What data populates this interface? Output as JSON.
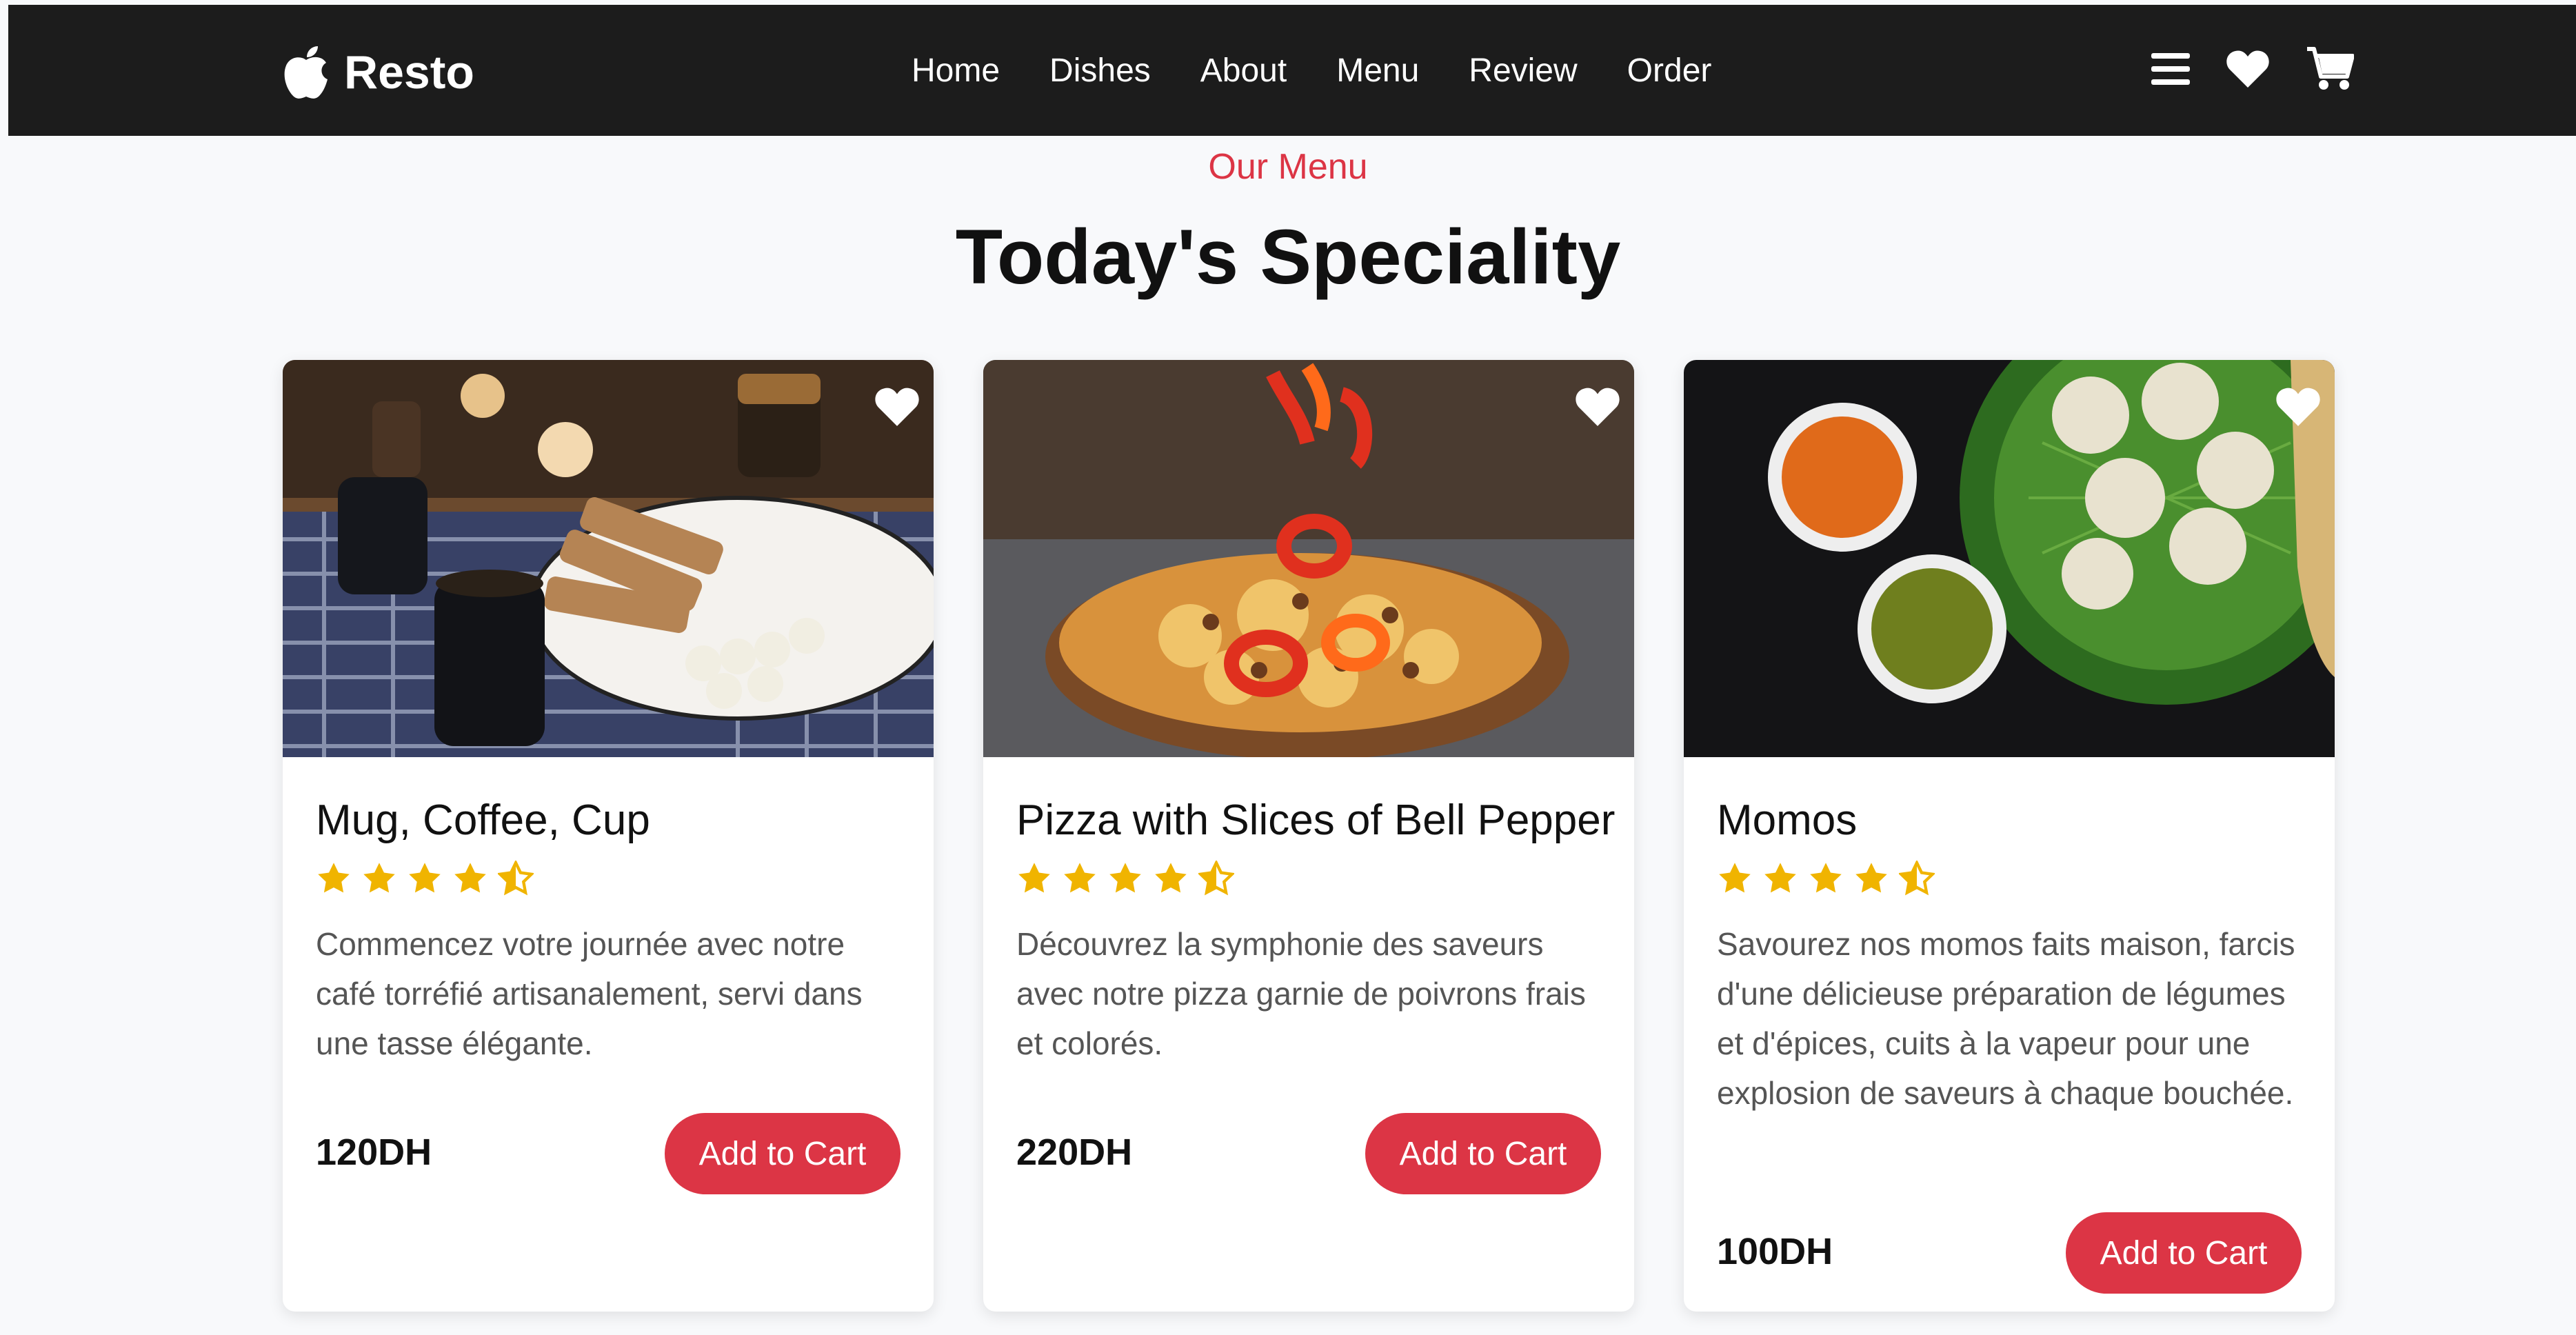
{
  "brand": {
    "name": "Resto",
    "logo_icon": "apple-icon"
  },
  "nav": {
    "links": [
      "Home",
      "Dishes",
      "About",
      "Menu",
      "Review",
      "Order"
    ],
    "icons": [
      "menu-icon",
      "heart-icon",
      "cart-icon"
    ]
  },
  "section": {
    "eyebrow": "Our Menu",
    "title": "Today's Speciality"
  },
  "colors": {
    "accent": "#dc3545",
    "navbar": "#1c1c1c",
    "star": "#f0b400"
  },
  "cards": [
    {
      "title": "Mug, Coffee, Cup",
      "rating": 4.5,
      "description": "Commencez votre journée avec notre café torréfié artisanalement, servi dans une tasse élégante.",
      "price": "120DH",
      "button": "Add to Cart",
      "image": "coffee-mugs-bread-photo"
    },
    {
      "title": "Pizza with Slices of Bell Pepper",
      "rating": 4.5,
      "description": "Découvrez la symphonie des saveurs avec notre pizza garnie de poivrons frais et colorés.",
      "price": "220DH",
      "button": "Add to Cart",
      "image": "pizza-bell-pepper-photo"
    },
    {
      "title": "Momos",
      "rating": 4.5,
      "description": "Savourez nos momos faits maison, farcis d'une délicieuse préparation de légumes et d'épices, cuits à la vapeur pour une explosion de saveurs à chaque bouchée.",
      "price": "100DH",
      "button": "Add to Cart",
      "image": "momos-dumplings-photo"
    }
  ]
}
